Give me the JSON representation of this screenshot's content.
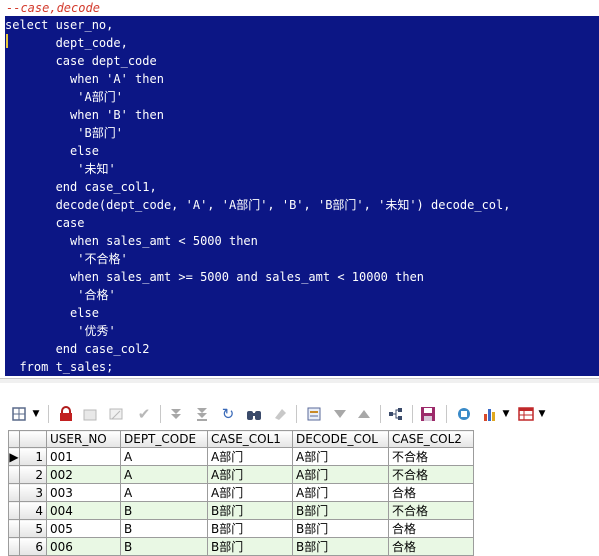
{
  "editor": {
    "comment": "--case,decode",
    "lines": [
      "select user_no,",
      "       dept_code,",
      "       case dept_code",
      "         when 'A' then",
      "          'A部门'",
      "         when 'B' then",
      "          'B部门'",
      "         else",
      "          '未知'",
      "       end case_col1,",
      "       decode(dept_code, 'A', 'A部门', 'B', 'B部门', '未知') decode_col,",
      "       case",
      "         when sales_amt < 5000 then",
      "          '不合格'",
      "         when sales_amt >= 5000 and sales_amt < 10000 then",
      "          '合格'",
      "         else",
      "          '优秀'",
      "       end case_col2",
      "  from t_sales;"
    ]
  },
  "toolbar": {
    "icons": [
      "grid-options-icon",
      "dropdown-arrow-icon",
      "lock-icon",
      "insert-record-icon",
      "delete-record-icon",
      "post-record-icon",
      "fetch-next-page-icon",
      "fetch-last-page-icon",
      "refresh-icon",
      "find-icon",
      "clear-icon",
      "query-by-example-icon",
      "sort-desc-icon",
      "sort-asc-icon",
      "tree-view-icon",
      "save-icon",
      "export-icon",
      "chart-icon",
      "chart-dropdown-icon",
      "table-view-icon",
      "table-dropdown-icon"
    ]
  },
  "grid": {
    "columns": [
      "USER_NO",
      "DEPT_CODE",
      "CASE_COL1",
      "DECODE_COL",
      "CASE_COL2"
    ],
    "rows": [
      {
        "no": "1",
        "cells": [
          "001",
          "A",
          "A部门",
          "A部门",
          "不合格"
        ]
      },
      {
        "no": "2",
        "cells": [
          "002",
          "A",
          "A部门",
          "A部门",
          "不合格"
        ]
      },
      {
        "no": "3",
        "cells": [
          "003",
          "A",
          "A部门",
          "A部门",
          "合格"
        ]
      },
      {
        "no": "4",
        "cells": [
          "004",
          "B",
          "B部门",
          "B部门",
          "不合格"
        ]
      },
      {
        "no": "5",
        "cells": [
          "005",
          "B",
          "B部门",
          "B部门",
          "合格"
        ]
      },
      {
        "no": "6",
        "cells": [
          "006",
          "B",
          "B部门",
          "B部门",
          "合格"
        ]
      }
    ]
  }
}
